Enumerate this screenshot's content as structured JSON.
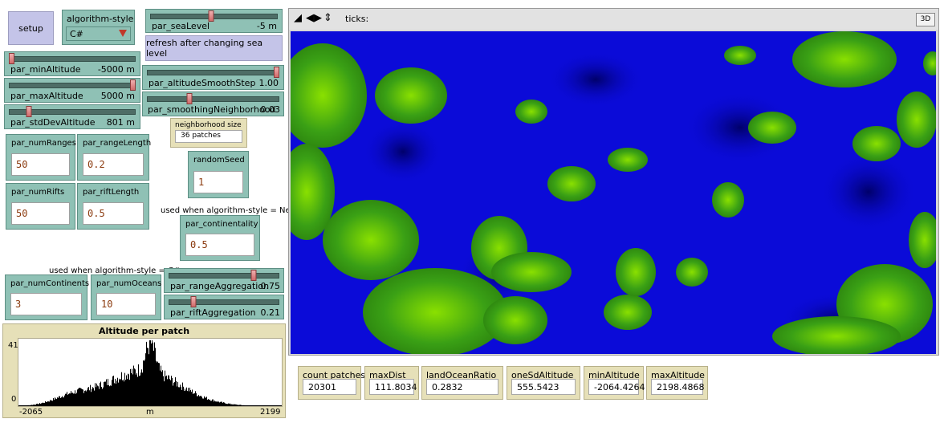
{
  "setup_button": {
    "label": "setup"
  },
  "chooser_algorithm": {
    "label": "algorithm-style",
    "value": "C#"
  },
  "slider_sea_level": {
    "label": "par_seaLevel",
    "value": "-5 m",
    "fraction": 0.47
  },
  "refresh_button": {
    "label": "refresh after changing sea level"
  },
  "slider_min_altitude": {
    "label": "par_minAltitude",
    "value": "-5000 m",
    "fraction": 0.0
  },
  "slider_max_altitude": {
    "label": "par_maxAltitude",
    "value": "5000 m",
    "fraction": 1.0
  },
  "slider_std_dev_altitude": {
    "label": "par_stdDevAltitude",
    "value": "801 m",
    "fraction": 0.15
  },
  "slider_altitude_smooth_step": {
    "label": "par_altitudeSmoothStep",
    "value": "1.00",
    "fraction": 1.0
  },
  "slider_smoothing_neighborhood": {
    "label": "par_smoothingNeighborhood",
    "value": "0.03",
    "fraction": 0.3
  },
  "monitor_neighborhood": {
    "label": "neighborhood size",
    "value": "36 patches"
  },
  "input_num_ranges": {
    "label": "par_numRanges",
    "value": "50"
  },
  "input_range_length": {
    "label": "par_rangeLength",
    "value": "0.2"
  },
  "input_num_rifts": {
    "label": "par_numRifts",
    "value": "50"
  },
  "input_rift_length": {
    "label": "par_riftLength",
    "value": "0.5"
  },
  "input_random_seed": {
    "label": "randomSeed",
    "value": "1"
  },
  "note_netlogo": "used when algorithm-style = Netlogo",
  "input_continentality": {
    "label": "par_continentality",
    "value": "0.5"
  },
  "note_csharp": "used when algorithm-style = C#",
  "input_num_continents": {
    "label": "par_numContinents",
    "value": "3"
  },
  "input_num_oceans": {
    "label": "par_numOceans",
    "value": "10"
  },
  "slider_range_aggregation": {
    "label": "par_rangeAggregation",
    "value": "0.75",
    "fraction": 0.75
  },
  "slider_rift_aggregation": {
    "label": "par_riftAggregation",
    "value": "0.21",
    "fraction": 0.21
  },
  "plot": {
    "title": "Altitude per patch",
    "y_max": "41",
    "y_min": "0",
    "x_min": "-2065",
    "x_max": "2199",
    "x_label": "m"
  },
  "view": {
    "ticks_label": "ticks:",
    "btn_3d": "3D"
  },
  "monitors": {
    "count_patches": {
      "label": "count patches",
      "value": "20301"
    },
    "max_dist": {
      "label": "maxDist",
      "value": "111.8034"
    },
    "land_ocean_ratio": {
      "label": "landOceanRatio",
      "value": "0.2832"
    },
    "one_sd_altitude": {
      "label": "oneSdAltitude",
      "value": "555.5423"
    },
    "min_altitude": {
      "label": "minAltitude",
      "value": "-2064.4264"
    },
    "max_altitude": {
      "label": "maxAltitude",
      "value": "2198.4868"
    }
  },
  "colors": {
    "ocean": "#0b0bd8",
    "land": "#2f8a10",
    "land_peak": "#8ae000",
    "widget_teal": "#8fc1b5",
    "monitor_beige": "#e6e0b8",
    "button_lavender": "#c4c4e8"
  }
}
